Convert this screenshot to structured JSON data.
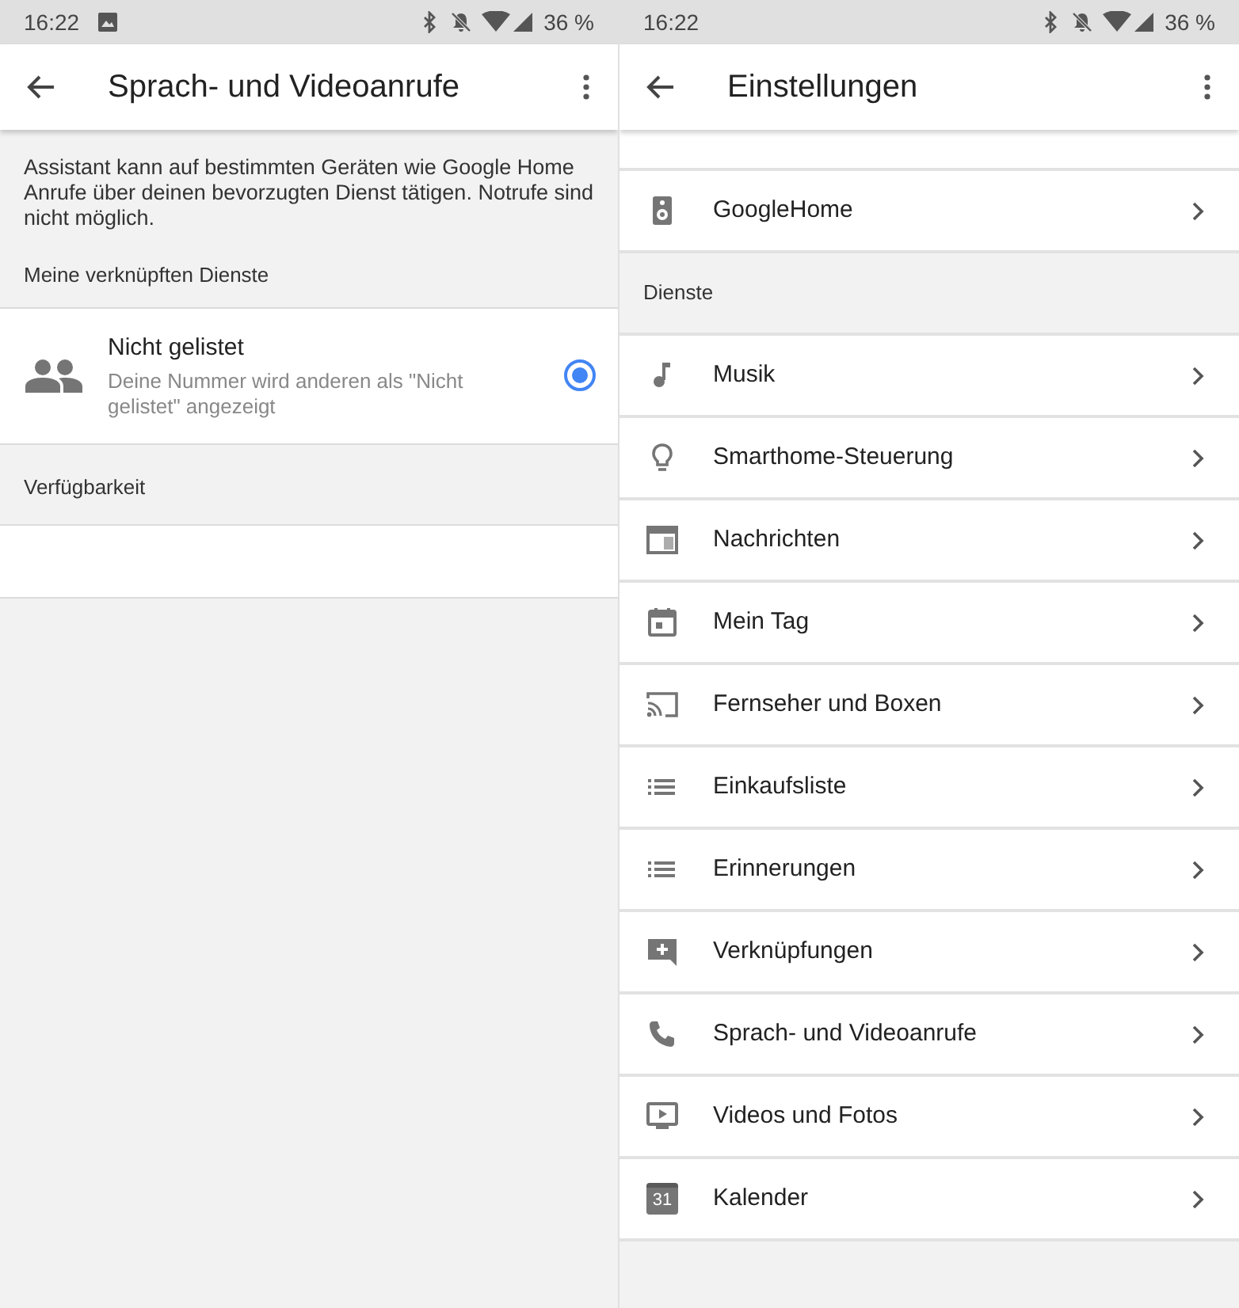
{
  "call_screen": {
    "status_bar": {
      "time": "16:22",
      "notification_icon": true,
      "battery": "36 %"
    },
    "app_bar": {
      "title": "Sprach- und Videoanrufe"
    },
    "description": "Assistant kann auf bestimmten Geräten wie Google Home Anrufe über deinen bevorzugten Dienst tätigen. Notrufe sind nicht möglich.",
    "linked_section": {
      "heading": "Meine verknüpften Dienste",
      "options": [
        {
          "title": "Nicht gelistet",
          "subtitle": "Deine Nummer wird anderen als \"Nicht gelistet\" angezeigt",
          "selected": true
        }
      ]
    },
    "availability_section": {
      "heading": "Verfügbarkeit"
    }
  },
  "settings_screen": {
    "status_bar": {
      "time": "16:22",
      "notification_icon": false,
      "battery": "36 %"
    },
    "app_bar": {
      "title": "Einstellungen"
    },
    "device_items": [
      {
        "label": "GoogleHome"
      }
    ],
    "services_heading": "Dienste",
    "service_items": [
      {
        "label": "Musik"
      },
      {
        "label": "Smarthome-Steuerung"
      },
      {
        "label": "Nachrichten"
      },
      {
        "label": "Mein Tag"
      },
      {
        "label": "Fernseher und Boxen"
      },
      {
        "label": "Einkaufsliste"
      },
      {
        "label": "Erinnerungen"
      },
      {
        "label": "Verknüpfungen"
      },
      {
        "label": "Sprach- und Videoanrufe"
      },
      {
        "label": "Videos und Fotos"
      },
      {
        "label": "Kalender",
        "icon_text": "31"
      }
    ]
  }
}
